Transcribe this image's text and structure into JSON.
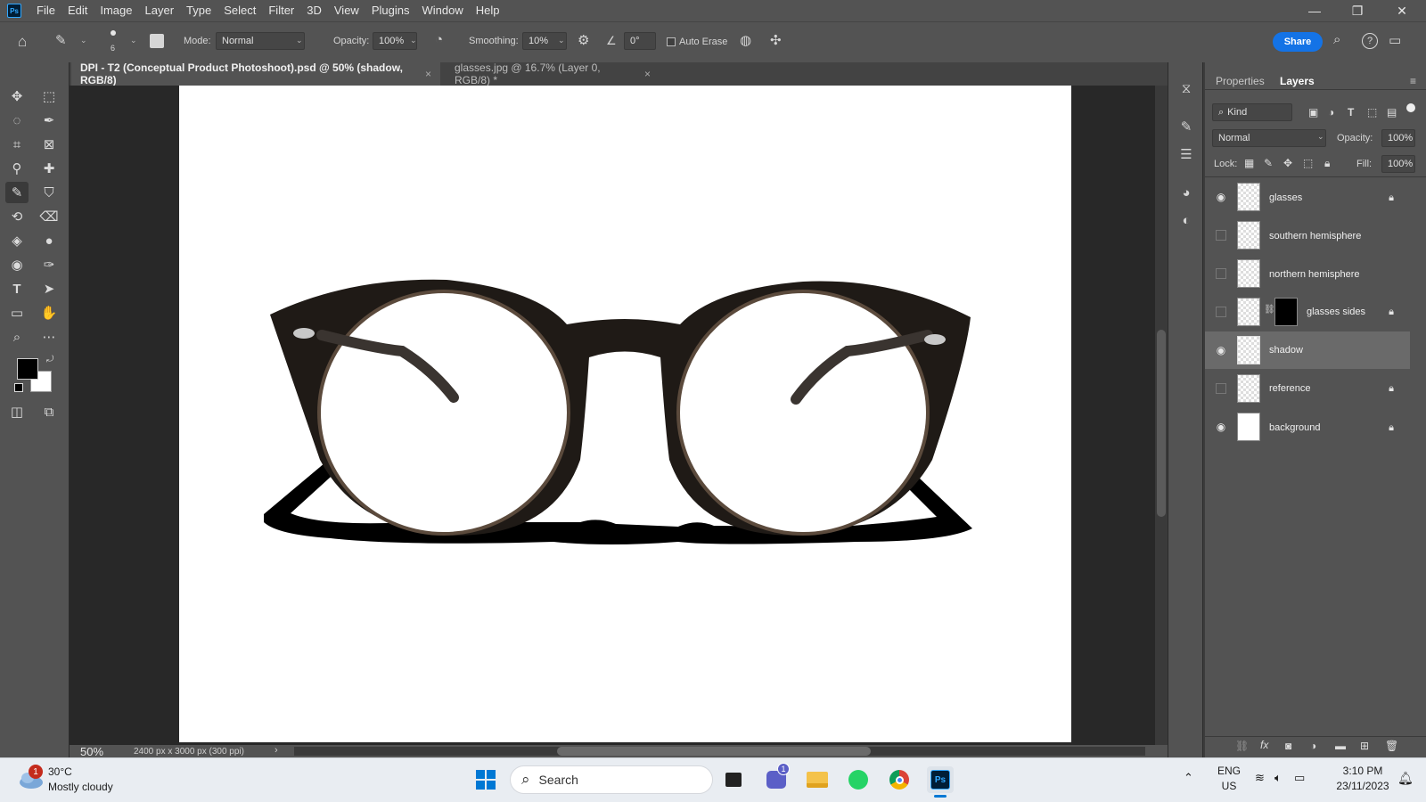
{
  "menubar": {
    "app_logo": "Ps",
    "items": [
      "File",
      "Edit",
      "Image",
      "Layer",
      "Type",
      "Select",
      "Filter",
      "3D",
      "View",
      "Plugins",
      "Window",
      "Help"
    ]
  },
  "options": {
    "brush_size": "6",
    "mode_label": "Mode:",
    "mode_value": "Normal",
    "opacity_label": "Opacity:",
    "opacity_value": "100%",
    "smoothing_label": "Smoothing:",
    "smoothing_value": "10%",
    "angle_value": "0°",
    "auto_erase_label": "Auto Erase",
    "share_label": "Share"
  },
  "tabs": [
    {
      "label": "DPI - T2 (Conceptual Product Photoshoot).psd @ 50% (shadow, RGB/8)"
    },
    {
      "label": "glasses.jpg @ 16.7% (Layer 0, RGB/8) *"
    }
  ],
  "status": {
    "zoom": "50%",
    "doc_size": "2400 px x 3000 px (300 ppi)"
  },
  "panel": {
    "tabs": [
      "Properties",
      "Layers"
    ],
    "filter_kind": "Kind",
    "blend_mode": "Normal",
    "opacity_label": "Opacity:",
    "opacity_value": "100%",
    "lock_label": "Lock:",
    "fill_label": "Fill:",
    "fill_value": "100%",
    "layers": [
      {
        "name": "glasses",
        "visible": true,
        "locked": true
      },
      {
        "name": "southern hemisphere",
        "visible": false,
        "locked": false
      },
      {
        "name": "northern hemisphere",
        "visible": false,
        "locked": false
      },
      {
        "name": "glasses sides",
        "visible": false,
        "locked": true
      },
      {
        "name": "shadow",
        "visible": true,
        "locked": false,
        "selected": true
      },
      {
        "name": "reference",
        "visible": false,
        "locked": true
      },
      {
        "name": "background",
        "visible": true,
        "locked": true
      }
    ]
  },
  "taskbar": {
    "weather_temp": "30°C",
    "weather_desc": "Mostly cloudy",
    "weather_badge": "1",
    "search_label": "Search",
    "teams_badge": "1",
    "lang_line1": "ENG",
    "lang_line2": "US",
    "time": "3:10 PM",
    "date": "23/11/2023"
  }
}
